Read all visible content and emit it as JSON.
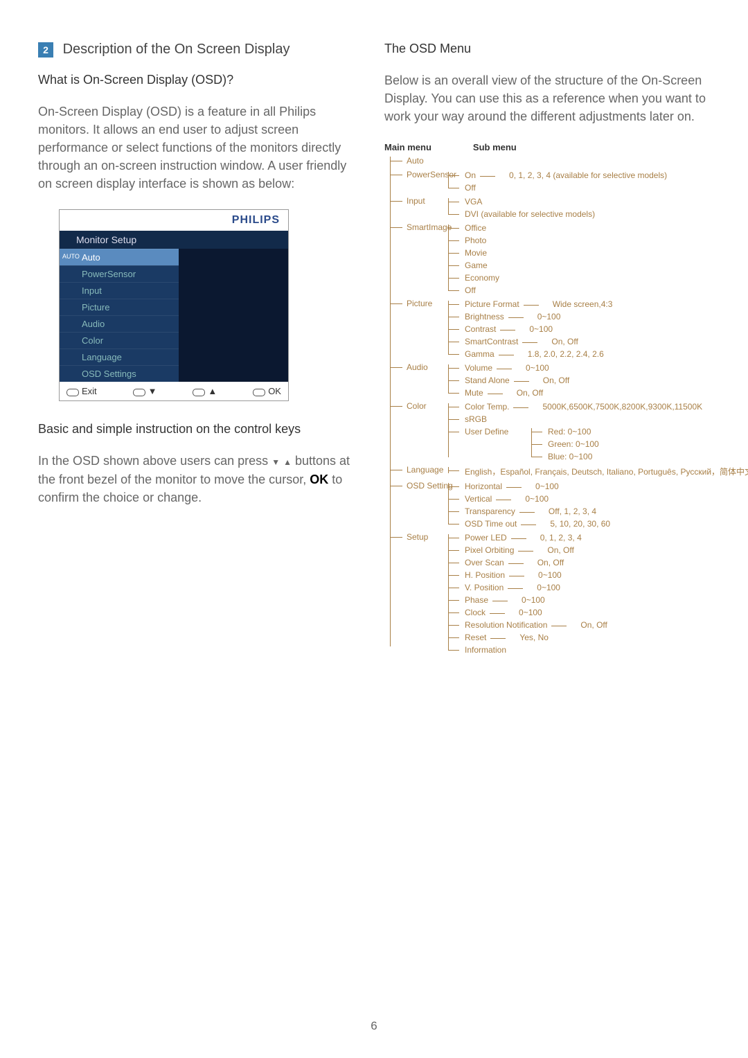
{
  "left": {
    "section_number": "2",
    "section_title": "Description of the On Screen Display",
    "q_title": "What is On-Screen Display (OSD)?",
    "para1": "On-Screen Display (OSD) is a feature in all Philips monitors. It allows an end user to adjust screen performance or select functions of the monitors directly through an on-screen instruction window. A user friendly on screen display interface is shown as below:",
    "osd": {
      "brand": "PHILIPS",
      "title": "Monitor Setup",
      "items": [
        {
          "label": "Auto",
          "selected": true
        },
        {
          "label": "PowerSensor",
          "selected": false
        },
        {
          "label": "Input",
          "selected": false
        },
        {
          "label": "Picture",
          "selected": false
        },
        {
          "label": "Audio",
          "selected": false
        },
        {
          "label": "Color",
          "selected": false
        },
        {
          "label": "Language",
          "selected": false
        },
        {
          "label": "OSD Settings",
          "selected": false
        }
      ],
      "foot": {
        "exit": "Exit",
        "ok": "OK"
      }
    },
    "instr_title": "Basic and simple instruction on the control keys",
    "instr_a": "In the OSD shown above users can press ",
    "instr_b": " buttons at the front bezel of the monitor to move the cursor, ",
    "instr_ok": "OK",
    "instr_c": " to confirm the choice or change."
  },
  "right": {
    "heading": "The OSD Menu",
    "para": "Below is an overall view of the structure of the On-Screen Display. You can use this as a reference when you want to work your way around the different adjustments later on.",
    "main_head": "Main menu",
    "sub_head": "Sub menu",
    "tree": [
      {
        "name": "Auto",
        "subs": []
      },
      {
        "name": "PowerSensor",
        "subs": [
          {
            "name": "On",
            "vals": "0, 1, 2, 3, 4 (available for selective models)"
          },
          {
            "name": "Off"
          }
        ]
      },
      {
        "name": "Input",
        "subs": [
          {
            "name": "VGA"
          },
          {
            "name": "DVI (available for selective models)"
          }
        ]
      },
      {
        "name": "SmartImage",
        "subs": [
          {
            "name": "Office"
          },
          {
            "name": "Photo"
          },
          {
            "name": "Movie"
          },
          {
            "name": "Game"
          },
          {
            "name": "Economy"
          },
          {
            "name": "Off"
          }
        ]
      },
      {
        "name": "Picture",
        "subs": [
          {
            "name": "Picture Format",
            "vals": "Wide screen,4:3"
          },
          {
            "name": "Brightness",
            "vals": "0~100"
          },
          {
            "name": "Contrast",
            "vals": "0~100"
          },
          {
            "name": "SmartContrast",
            "vals": "On, Off"
          },
          {
            "name": "Gamma",
            "vals": "1.8, 2.0, 2.2, 2.4, 2.6"
          }
        ]
      },
      {
        "name": "Audio",
        "subs": [
          {
            "name": "Volume",
            "vals": "0~100"
          },
          {
            "name": "Stand Alone",
            "vals": "On, Off"
          },
          {
            "name": "Mute",
            "vals": "On, Off"
          }
        ]
      },
      {
        "name": "Color",
        "subs": [
          {
            "name": "Color Temp.",
            "vals": "5000K,6500K,7500K,8200K,9300K,11500K"
          },
          {
            "name": "sRGB"
          },
          {
            "name": "User Define",
            "nested": [
              "Red: 0~100",
              "Green: 0~100",
              "Blue: 0~100"
            ]
          }
        ]
      },
      {
        "name": "Language",
        "subs": [
          {
            "name": "English，Español, Français, Deutsch, Italiano, Português, Русский，简体中文"
          }
        ]
      },
      {
        "name": "OSD Setting",
        "subs": [
          {
            "name": "Horizontal",
            "vals": "0~100"
          },
          {
            "name": "Vertical",
            "vals": "0~100"
          },
          {
            "name": "Transparency",
            "vals": "Off, 1, 2, 3, 4"
          },
          {
            "name": "OSD Time out",
            "vals": "5, 10, 20, 30, 60"
          }
        ]
      },
      {
        "name": "Setup",
        "subs": [
          {
            "name": "Power LED",
            "vals": "0, 1, 2, 3, 4"
          },
          {
            "name": "Pixel Orbiting",
            "vals": "On, Off"
          },
          {
            "name": "Over Scan",
            "vals": "On, Off"
          },
          {
            "name": "H. Position",
            "vals": "0~100"
          },
          {
            "name": "V. Position",
            "vals": "0~100"
          },
          {
            "name": "Phase",
            "vals": "0~100"
          },
          {
            "name": "Clock",
            "vals": "0~100"
          },
          {
            "name": "Resolution Notification",
            "vals": "On, Off"
          },
          {
            "name": "Reset",
            "vals": "Yes, No"
          },
          {
            "name": "Information"
          }
        ]
      }
    ]
  },
  "page_number": "6"
}
